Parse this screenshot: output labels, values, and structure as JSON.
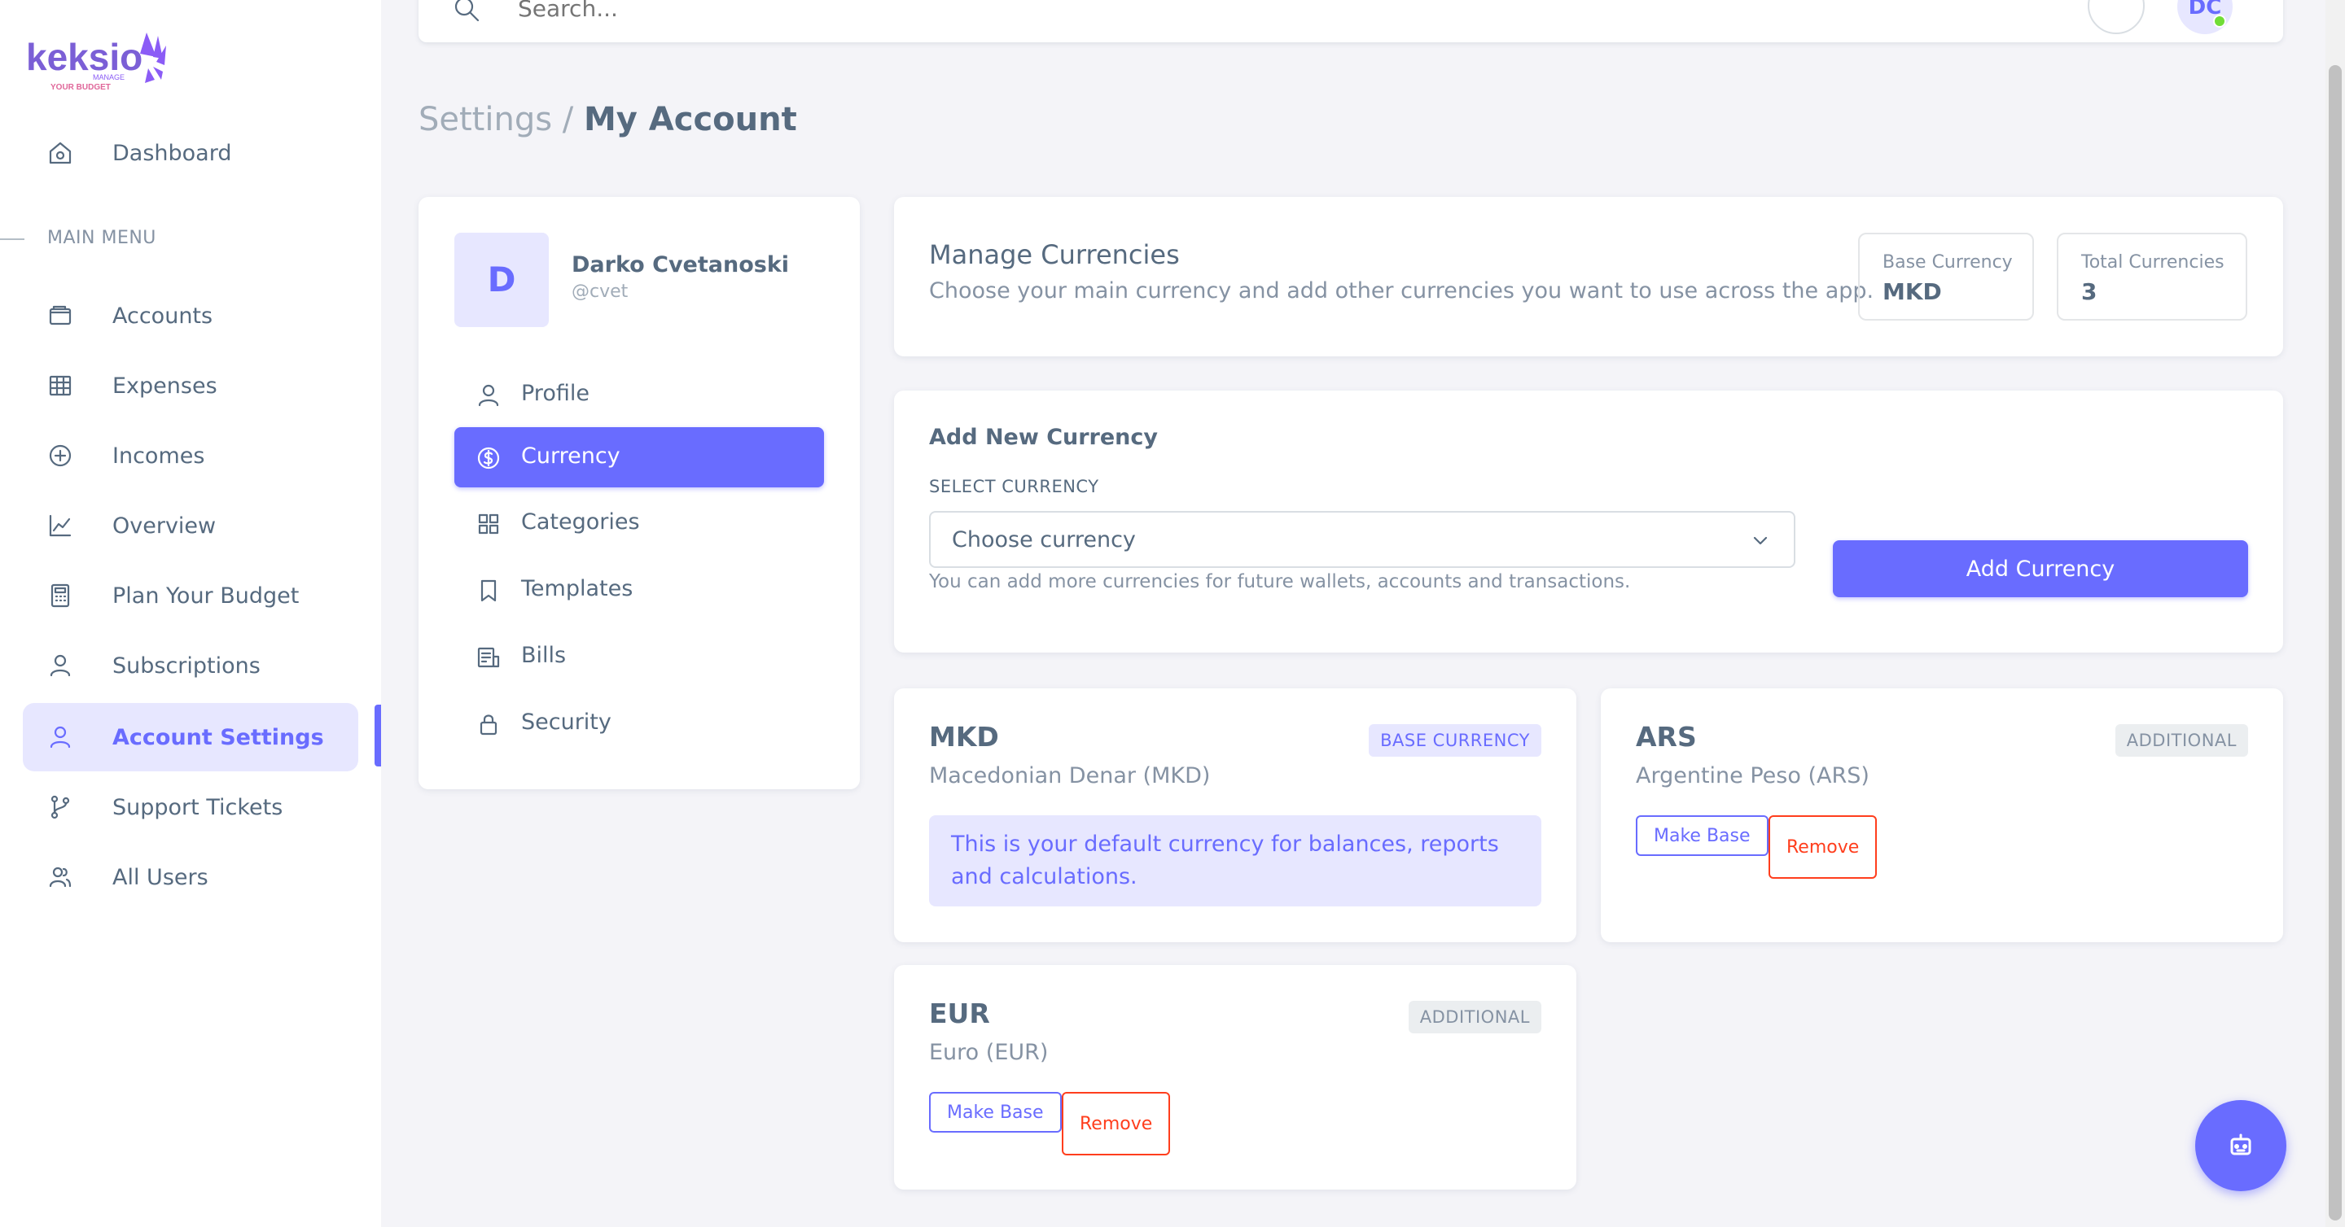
{
  "app": {
    "brand": "keksio",
    "tagline": "MANAGE YOUR BUDGET"
  },
  "sidebar": {
    "dashboard": "Dashboard",
    "section_label": "MAIN MENU",
    "items": [
      {
        "label": "Accounts"
      },
      {
        "label": "Expenses"
      },
      {
        "label": "Incomes"
      },
      {
        "label": "Overview"
      },
      {
        "label": "Plan Your Budget"
      },
      {
        "label": "Subscriptions"
      },
      {
        "label": "Account Settings"
      },
      {
        "label": "Support Tickets"
      },
      {
        "label": "All Users"
      }
    ]
  },
  "topbar": {
    "search_placeholder": "Search...",
    "avatar_initials": "DC"
  },
  "breadcrumb": {
    "parent": "Settings /",
    "current": "My Account"
  },
  "account": {
    "initial": "D",
    "name": "Darko Cvetanoski",
    "handle": "@cvet",
    "menu": [
      {
        "label": "Profile"
      },
      {
        "label": "Currency"
      },
      {
        "label": "Categories"
      },
      {
        "label": "Templates"
      },
      {
        "label": "Bills"
      },
      {
        "label": "Security"
      }
    ]
  },
  "manage": {
    "title": "Manage Currencies",
    "subtitle": "Choose your main currency and add other currencies you want to use across the app.",
    "base_label": "Base Currency",
    "base_value": "MKD",
    "total_label": "Total Currencies",
    "total_value": "3"
  },
  "add": {
    "title": "Add New Currency",
    "select_label": "SELECT CURRENCY",
    "select_value": "Choose currency",
    "help": "You can add more currencies for future wallets, accounts and transactions.",
    "button": "Add Currency"
  },
  "currencies": [
    {
      "code": "MKD",
      "name": "Macedonian Denar (MKD)",
      "badge": "BASE CURRENCY",
      "info": "This is your default currency for balances, reports and calculations."
    },
    {
      "code": "ARS",
      "name": "Argentine Peso (ARS)",
      "badge": "ADDITIONAL",
      "make_base": "Make Base",
      "remove": "Remove"
    },
    {
      "code": "EUR",
      "name": "Euro (EUR)",
      "badge": "ADDITIONAL",
      "make_base": "Make Base",
      "remove": "Remove"
    }
  ],
  "colors": {
    "primary": "#696cff",
    "primary_light": "#e7e7ff",
    "danger": "#ff3e1d",
    "text": "#566a7f",
    "muted": "#8592a3",
    "background": "#f4f4f8"
  }
}
